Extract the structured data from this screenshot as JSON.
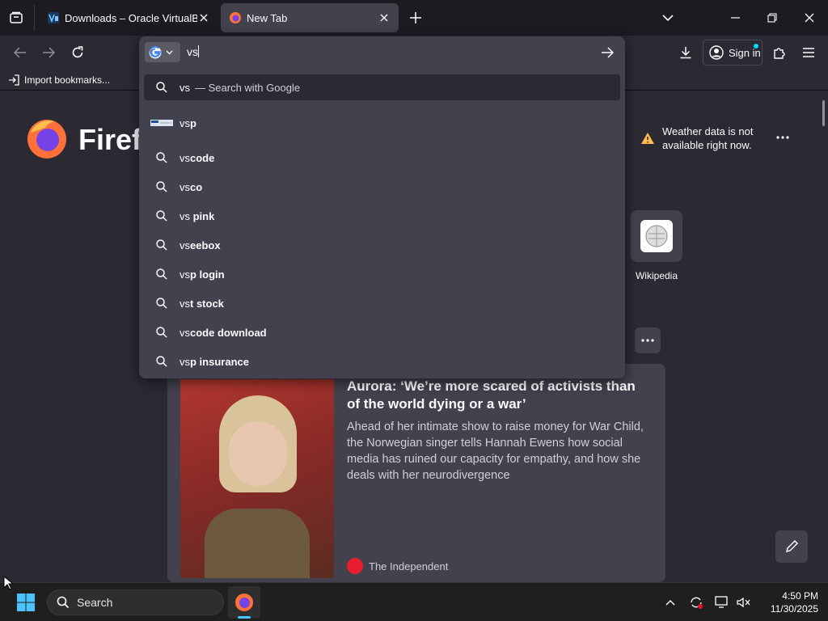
{
  "tabs": [
    {
      "title": "Downloads – Oracle VirtualBox",
      "active": false
    },
    {
      "title": "New Tab",
      "active": true
    }
  ],
  "toolbar": {
    "sign_in_label": "Sign in"
  },
  "bookmarks": {
    "import_label": "Import bookmarks..."
  },
  "urlbar": {
    "value": "vs",
    "search_with_prefix": "vs",
    "search_with_label": "— Search with Google",
    "suggestions": [
      {
        "typed": "vs",
        "rest": "p",
        "kind": "site"
      },
      {
        "typed": "vs",
        "rest": "code",
        "kind": "search"
      },
      {
        "typed": "vs",
        "rest": "co",
        "kind": "search"
      },
      {
        "typed": "vs",
        "rest": " pink",
        "kind": "search"
      },
      {
        "typed": "vs",
        "rest": "eebox",
        "kind": "search"
      },
      {
        "typed": "vs",
        "rest": "p login",
        "kind": "search"
      },
      {
        "typed": "vs",
        "rest": "t stock",
        "kind": "search"
      },
      {
        "typed": "vs",
        "rest": "code download",
        "kind": "search"
      },
      {
        "typed": "vs",
        "rest": "p insurance",
        "kind": "search"
      }
    ]
  },
  "newtab": {
    "logo_text": "Firefox",
    "weather_message": "Weather data is not available right now.",
    "shortcut_label": "Wikipedia",
    "story": {
      "headline": "Aurora: ‘We’re more scared of activists than of the world dying or a war’",
      "excerpt": "Ahead of her intimate show to raise money for War Child, the Norwegian singer tells Hannah Ewens how social media has ruined our capacity for empathy, and how she deals with her neurodivergence",
      "source": "The Independent"
    }
  },
  "taskbar": {
    "search_label": "Search",
    "time": "4:50 PM",
    "date": "11/30/2025"
  },
  "colors": {
    "accent": "#00ddff",
    "background": "#1c1b22",
    "surface": "#2b2a33",
    "popup": "#42414d"
  }
}
